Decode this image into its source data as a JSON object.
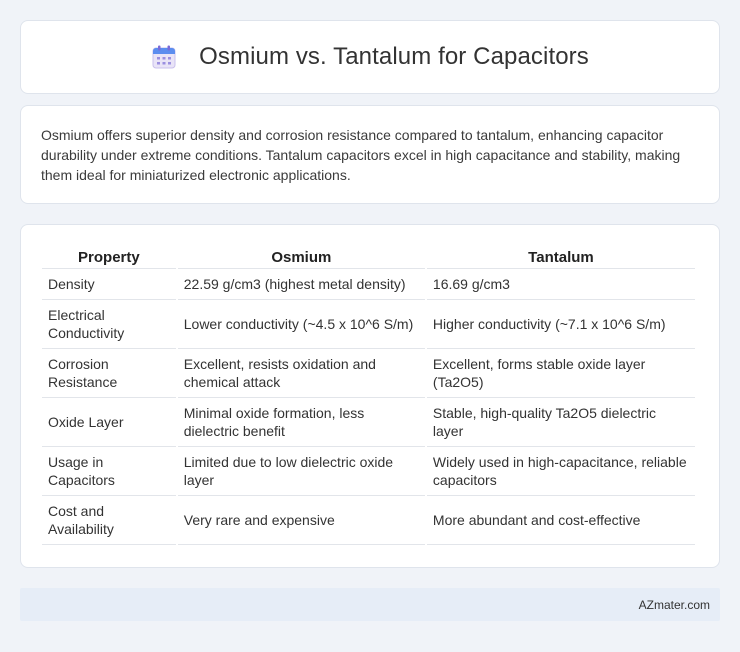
{
  "header": {
    "title": "Osmium vs. Tantalum for Capacitors",
    "icon": "calendar-icon"
  },
  "summary": "Osmium offers superior density and corrosion resistance compared to tantalum, enhancing capacitor durability under extreme conditions. Tantalum capacitors excel in high capacitance and stability, making them ideal for miniaturized electronic applications.",
  "table": {
    "headers": [
      "Property",
      "Osmium",
      "Tantalum"
    ],
    "rows": [
      [
        "Density",
        "22.59 g/cm3 (highest metal density)",
        "16.69 g/cm3"
      ],
      [
        "Electrical Conductivity",
        "Lower conductivity (~4.5 x 10^6 S/m)",
        "Higher conductivity (~7.1 x 10^6 S/m)"
      ],
      [
        "Corrosion Resistance",
        "Excellent, resists oxidation and chemical attack",
        "Excellent, forms stable oxide layer (Ta2O5)"
      ],
      [
        "Oxide Layer",
        "Minimal oxide formation, less dielectric benefit",
        "Stable, high-quality Ta2O5 dielectric layer"
      ],
      [
        "Usage in Capacitors",
        "Limited due to low dielectric oxide layer",
        "Widely used in high-capacitance, reliable capacitors"
      ],
      [
        "Cost and Availability",
        "Very rare and expensive",
        "More abundant and cost-effective"
      ]
    ]
  },
  "footer": {
    "text": "AZmater.com"
  }
}
